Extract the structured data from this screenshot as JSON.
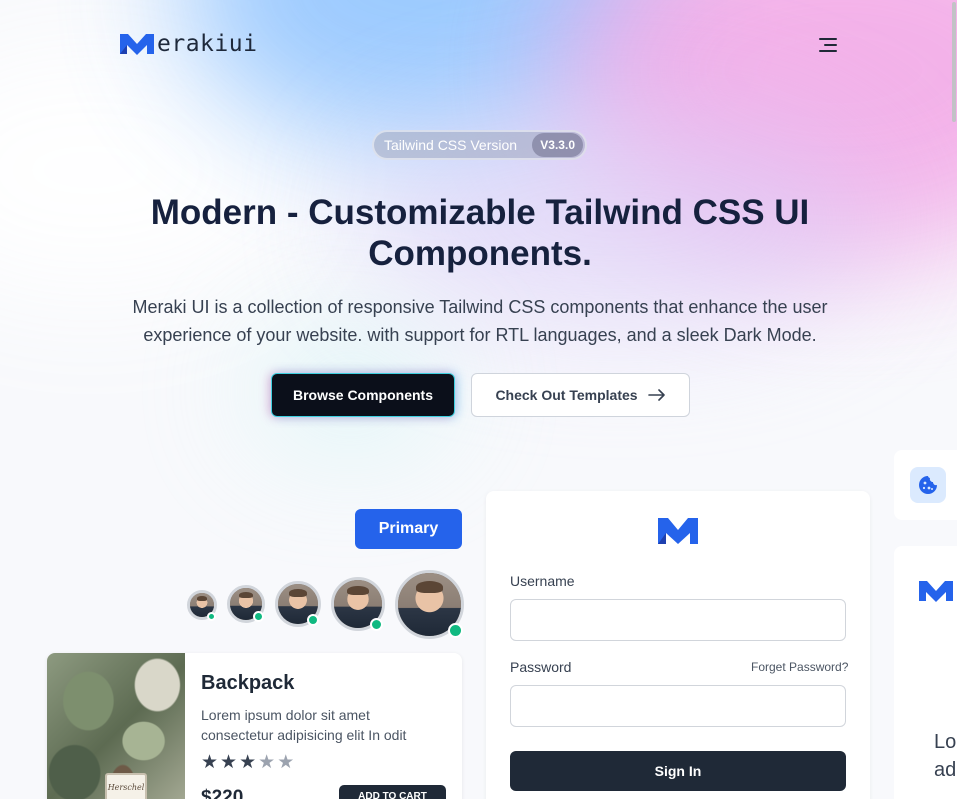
{
  "header": {
    "logo_text": "erakiui",
    "brand_color": "#2563eb",
    "menu_icon": "menu-icon"
  },
  "hero": {
    "badge_label": "Tailwind CSS Version",
    "badge_version": "V3.3.0",
    "title_line1": "Modern - Customizable Tailwind CSS UI",
    "title_line2": "Components.",
    "subtitle_line1": "Meraki UI is a collection of responsive Tailwind CSS components that enhance the user",
    "subtitle_line2": "experience of your website. with support for RTL languages, and a sleek Dark Mode.",
    "browse_label": "Browse Components",
    "templates_label": "Check Out Templates",
    "templates_icon": "arrow-right-icon"
  },
  "showcase": {
    "primary_label": "Primary",
    "avatars": [
      {
        "online": true
      },
      {
        "online": true
      },
      {
        "online": true
      },
      {
        "online": true
      },
      {
        "online": true
      }
    ],
    "product": {
      "title": "Backpack",
      "desc_line1": "Lorem ipsum dolor sit amet",
      "desc_line2": "consectetur adipisicing elit In odit",
      "rating": 3,
      "rating_max": 5,
      "price": "$220",
      "cart_label": "ADD TO CART",
      "tag_text": "Herschel"
    },
    "login": {
      "username_label": "Username",
      "password_label": "Password",
      "forgot_label": "Forget Password?",
      "signin_label": "Sign In",
      "username_value": "",
      "password_value": ""
    },
    "side": {
      "cookie_icon": "cookie-icon",
      "text_line1": "Lo",
      "text_line2": "ad"
    }
  }
}
